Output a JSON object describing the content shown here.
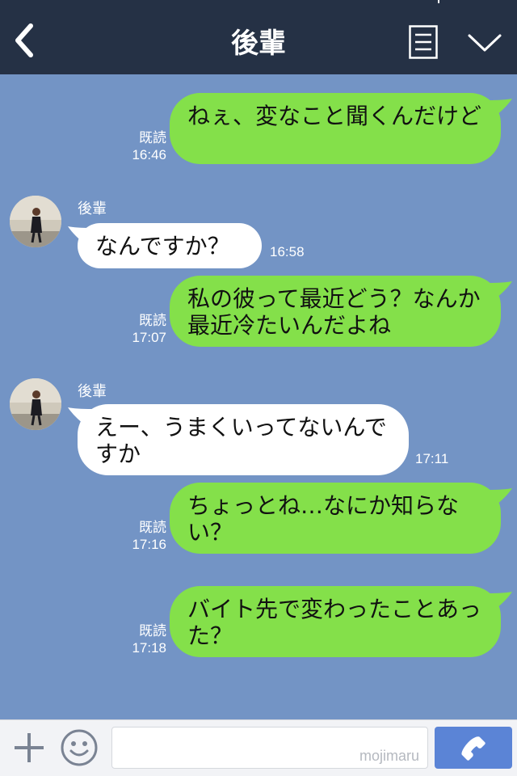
{
  "header": {
    "title": "後輩"
  },
  "messages": [
    {
      "dir": "out",
      "text": "ねぇ、変なこと聞くんだけど",
      "read": "既読",
      "time": "16:46"
    },
    {
      "dir": "in",
      "sender": "後輩",
      "text": "なんですか？",
      "time": "16:58"
    },
    {
      "dir": "out",
      "text": "私の彼って最近どう？なんか最近冷たいんだよね",
      "read": "既読",
      "time": "17:07"
    },
    {
      "dir": "in",
      "sender": "後輩",
      "text": "えー、うまくいってないんですか",
      "time": "17:11"
    },
    {
      "dir": "out",
      "text": "ちょっとね…なにか知らない？",
      "read": "既読",
      "time": "17:16"
    },
    {
      "dir": "out",
      "text": "バイト先で変わったことあった？",
      "read": "既読",
      "time": "17:18"
    }
  ],
  "footer": {
    "watermark": "mojimaru"
  },
  "colors": {
    "header_bg": "#253145",
    "chat_bg": "#7394c5",
    "outgoing_bubble": "#84e04a",
    "incoming_bubble": "#ffffff",
    "call_button": "#5b84d6"
  },
  "icons": {
    "back": "back-chevron-icon",
    "menu": "menu-list-icon",
    "collapse": "chevron-down-icon",
    "add": "plus-icon",
    "emoji": "smiley-icon",
    "call": "phone-icon"
  }
}
